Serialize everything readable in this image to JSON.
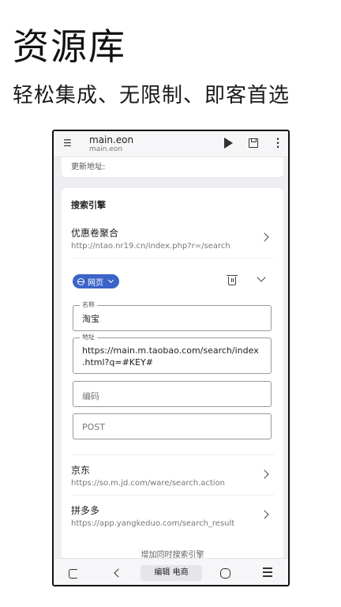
{
  "promo": {
    "title": "资源库",
    "subtitle": "轻松集成、无限制、即客首选"
  },
  "appbar": {
    "title": "main.eon",
    "subtitle": "main.eon",
    "icons": [
      "menu-icon",
      "play-icon",
      "save-icon",
      "more-vert-icon"
    ]
  },
  "top_card": {
    "update_label": "更新地址:"
  },
  "search": {
    "section_title": "搜索引擎",
    "engines": [
      {
        "name": "优惠卷聚合",
        "url": "http://ntao.nr19.cn/index.php?r=/search"
      }
    ],
    "editor": {
      "type_chip": "网页",
      "fields": {
        "name": {
          "label": "名称",
          "value": "淘宝"
        },
        "address": {
          "label": "地址",
          "value_line1": "https://main.m.taobao.com/search/index",
          "value_line2": ".html?q=#KEY#"
        },
        "encoding": {
          "placeholder": "编码"
        },
        "method": {
          "placeholder": "POST"
        }
      }
    },
    "more_engines": [
      {
        "name": "京东",
        "url": "https://so.m.jd.com/ware/search.action"
      },
      {
        "name": "拼多多",
        "url": "https://app.yangkeduo.com/search_result"
      }
    ],
    "add_link": "增加同时搜索引擎"
  },
  "bottombar": {
    "center_label": "编辑 电商"
  }
}
